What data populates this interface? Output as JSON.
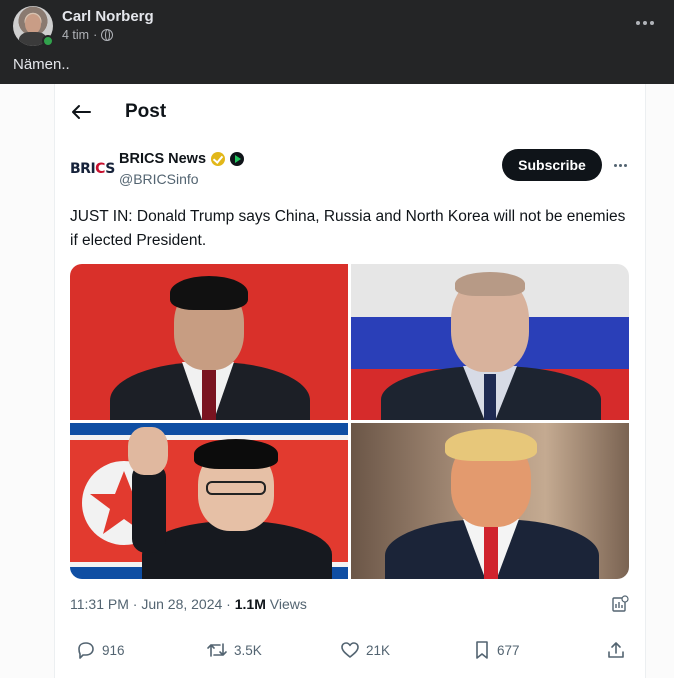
{
  "facebook_post": {
    "author_name": "Carl Norberg",
    "time_ago": "4 tim",
    "separator": "·",
    "caption": "Nämen.."
  },
  "tweet": {
    "header_title": "Post",
    "account": {
      "logo_text_prefix": "BRI",
      "logo_text_c": "C",
      "logo_text_suffix": "S",
      "display_name": "BRICS News",
      "handle": "@BRICSinfo"
    },
    "subscribe_label": "Subscribe",
    "text": "JUST IN: Donald Trump says China, Russia and North Korea will not be enemies if elected President.",
    "timestamp": "11:31 PM · Jun 28, 2024 · ",
    "views_count": "1.1M",
    "views_label": " Views",
    "actions": {
      "replies": "916",
      "reposts": "3.5K",
      "likes": "21K",
      "bookmarks": "677"
    }
  },
  "colors": {
    "fb_background": "#242526",
    "online_green": "#31a24c",
    "verified_gold": "#e2b719",
    "subscribe_bg": "#0f1419",
    "muted_text": "#536471"
  },
  "icons": [
    "globe-icon",
    "more-icon",
    "back-arrow-icon",
    "verified-icon",
    "affiliate-badge-icon",
    "reply-icon",
    "repost-icon",
    "like-icon",
    "bookmark-icon",
    "share-icon",
    "analytics-icon"
  ]
}
